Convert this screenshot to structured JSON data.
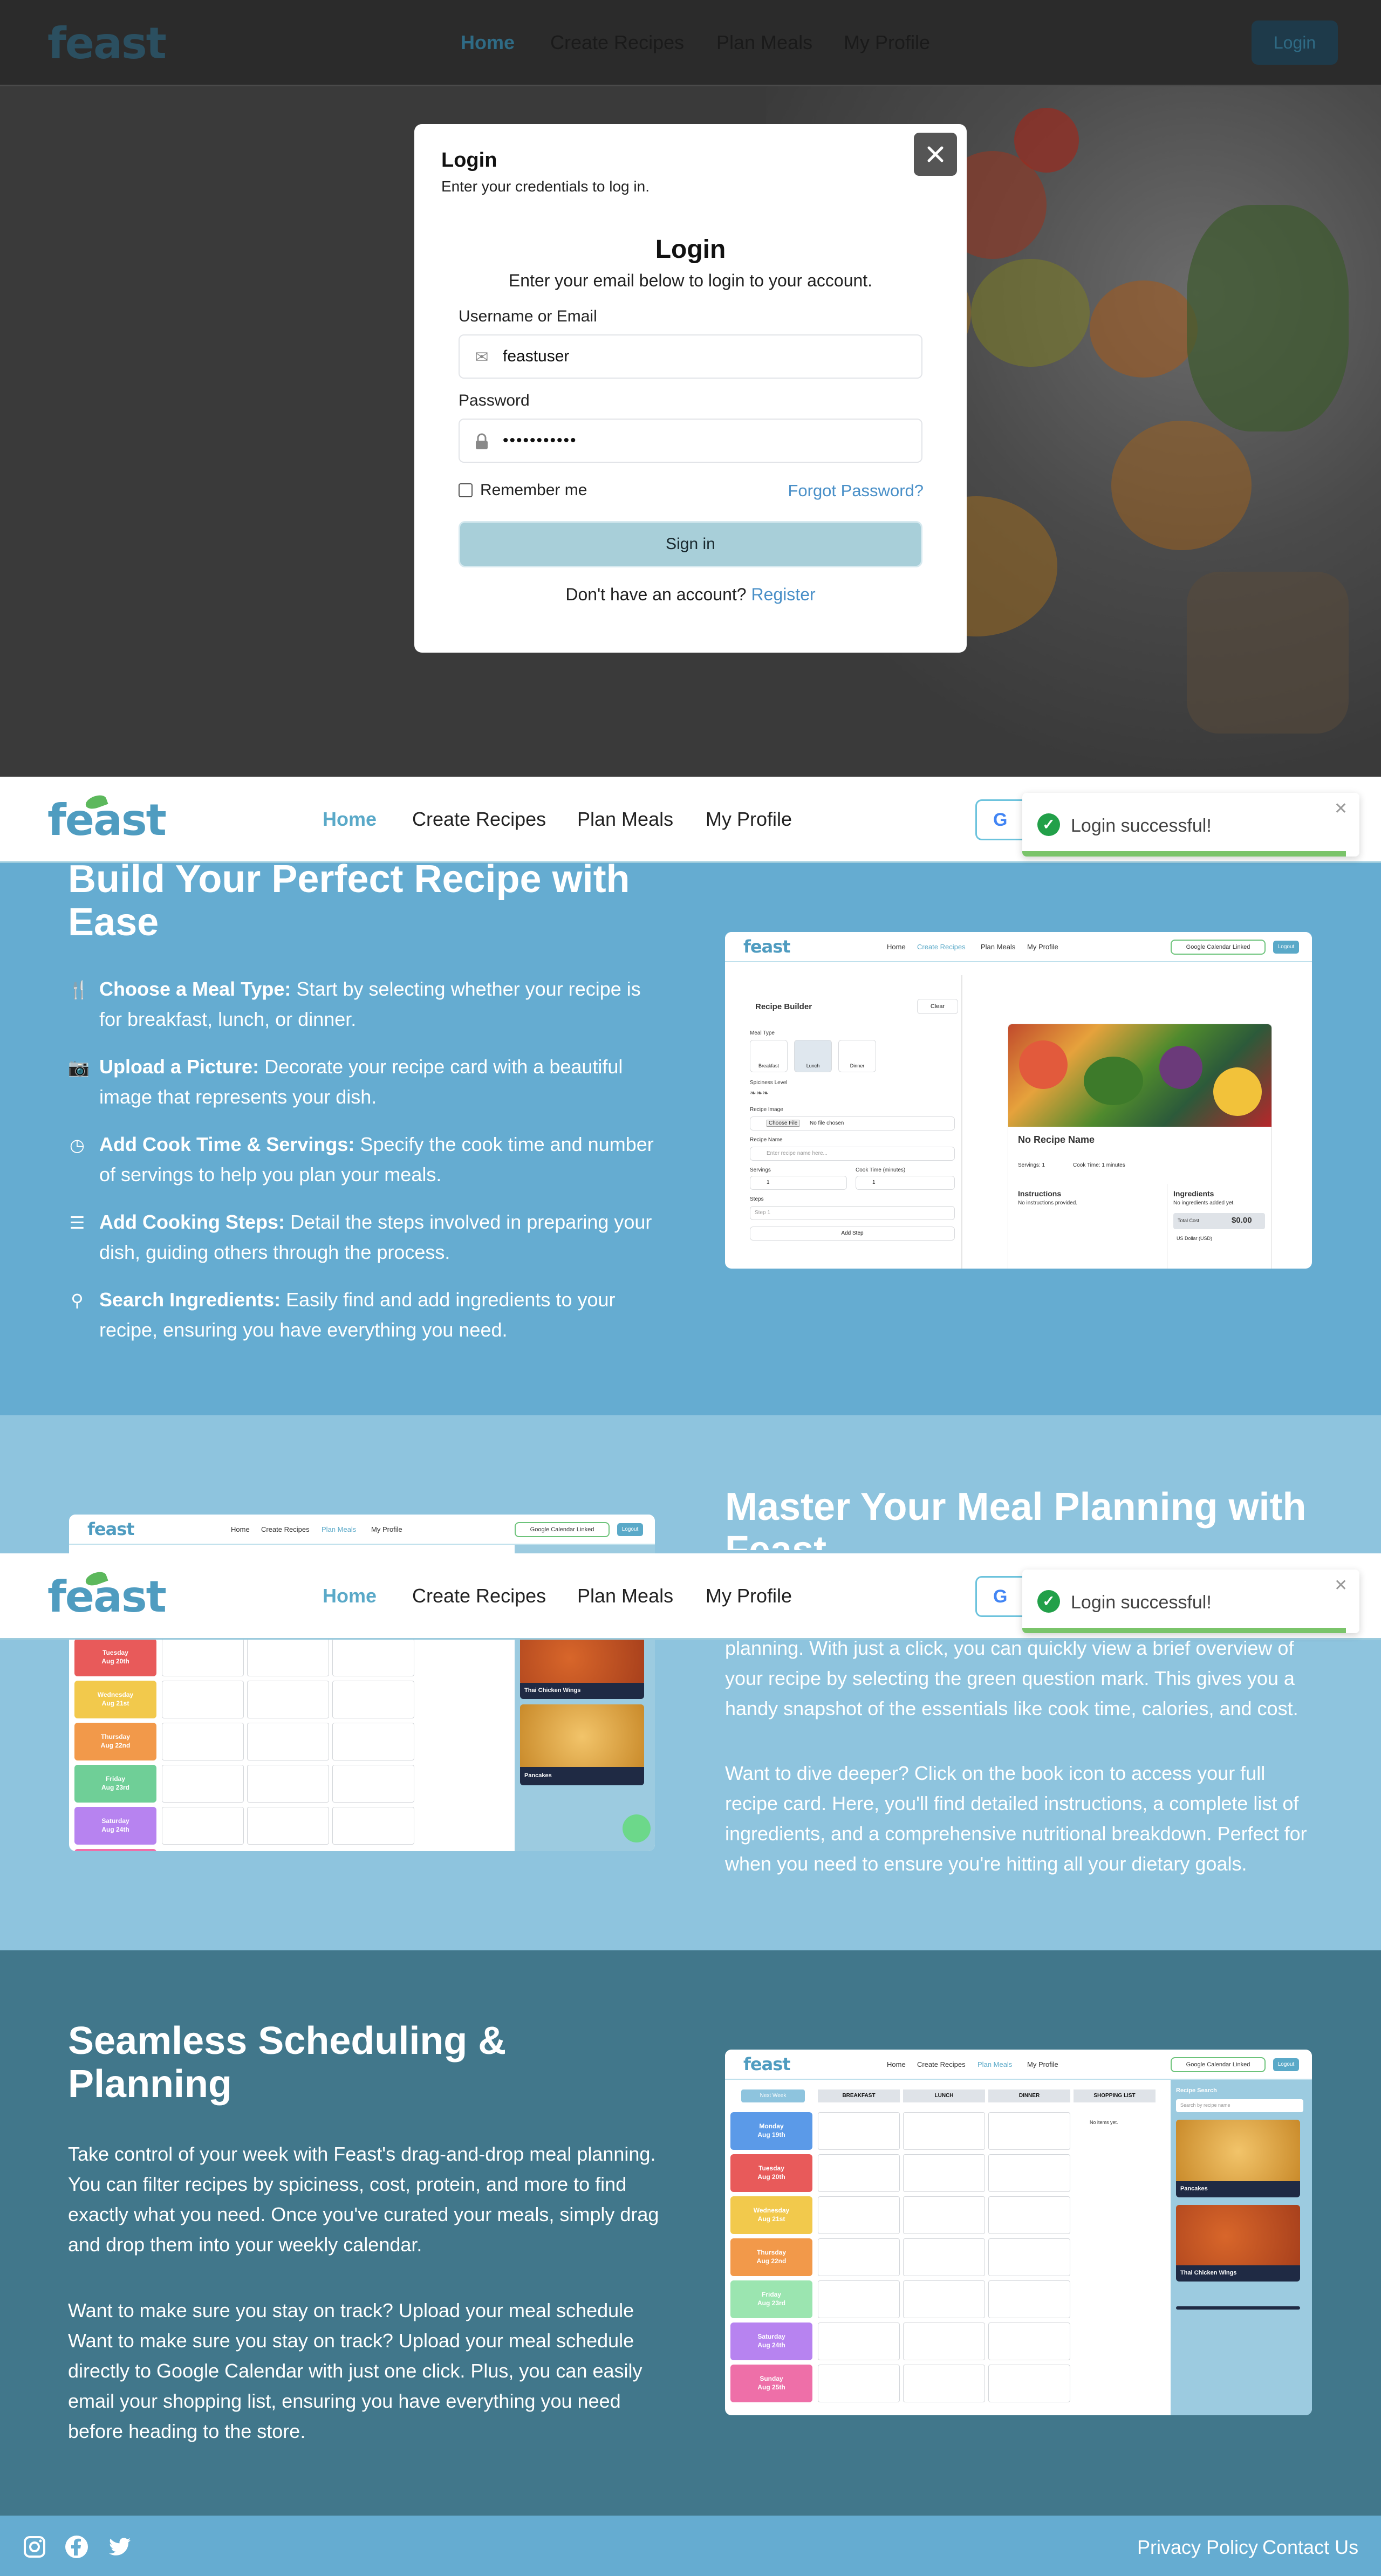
{
  "brand": {
    "logo": "feast",
    "accent": "#5aa9c8",
    "logo_color": "#4f9cc0",
    "leaf_color": "#5cb85c"
  },
  "nav": {
    "links": [
      "Home",
      "Create Recipes",
      "Plan Meals",
      "My Profile"
    ],
    "login_button": "Login"
  },
  "modal": {
    "header_title": "Login",
    "header_subtitle": "Enter your credentials to log in.",
    "title": "Login",
    "subtitle": "Enter your email below to login to your account.",
    "username_label": "Username or Email",
    "username_value": "feastuser",
    "password_label": "Password",
    "password_value": "•••••••••••",
    "remember_label": "Remember me",
    "forgot_link": "Forgot Password?",
    "submit": "Sign in",
    "no_account": "Don't have an account?",
    "register_link": "Register"
  },
  "toast": {
    "message": "Login successful!"
  },
  "feature1": {
    "title": "Build Your Perfect Recipe with Ease",
    "items": [
      {
        "icon": "utensils-icon",
        "bold": "Choose a Meal Type:",
        "text": "Start by selecting whether your recipe is for breakfast, lunch, or dinner."
      },
      {
        "icon": "camera-icon",
        "bold": "Upload a Picture:",
        "text": "Decorate your recipe card with a beautiful image that represents your dish."
      },
      {
        "icon": "clock-icon",
        "bold": "Add Cook Time & Servings:",
        "text": "Specify the cook time and number of servings to help you plan your meals."
      },
      {
        "icon": "list-icon",
        "bold": "Add Cooking Steps:",
        "text": "Detail the steps involved in preparing your dish, guiding others through the process."
      },
      {
        "icon": "search-icon",
        "bold": "Search Ingredients:",
        "text": "Easily find and add ingredients to your recipe, ensuring you have everything you need."
      }
    ],
    "shot": {
      "nav": [
        "Home",
        "Create Recipes",
        "Plan Meals",
        "My Profile"
      ],
      "calendar_btn": "Google Calendar Linked",
      "logout": "Logout",
      "builder_title": "Recipe Builder",
      "clear": "Clear",
      "meal_type": "Meal Type",
      "meals": [
        "Breakfast",
        "Lunch",
        "Dinner"
      ],
      "spiciness": "Spiciness Level",
      "recipe_image": "Recipe Image",
      "choose_file": "Choose File",
      "no_file": "No file chosen",
      "recipe_name_label": "Recipe Name",
      "recipe_name_placeholder": "Enter recipe name here...",
      "servings": "Servings",
      "cook_time": "Cook Time (minutes)",
      "steps": "Steps",
      "step_placeholder": "Step 1",
      "add_step": "Add Step",
      "card_title": "No Recipe Name",
      "card_servings": "Servings: 1",
      "card_cook": "Cook Time: 1 minutes",
      "instructions": "Instructions",
      "no_instructions": "No instructions provided.",
      "ingredients": "Ingredients",
      "no_ingredients": "No ingredients added yet.",
      "total_cost": "Total Cost",
      "total_value": "$0.00",
      "currency": "US Dollar (USD)"
    }
  },
  "feature2": {
    "title": "Master Your Meal Planning with Feast",
    "para1": "planning. With just a click, you can quickly view a brief overview of your recipe by selecting the green question mark. This gives you a handy snapshot of the essentials like cook time, calories, and cost.",
    "para2": "Want to dive deeper? Click on the book icon to access your full recipe card. Here, you'll find detailed instructions, a complete list of ingredients, and a comprehensive nutritional breakdown. Perfect for when you need to ensure you're hitting all your dietary goals.",
    "shot": {
      "days": [
        "Tuesday",
        "Wednesday",
        "Thursday",
        "Friday",
        "Saturday"
      ],
      "dates": [
        "Aug 20th",
        "Aug 21st",
        "Aug 22nd",
        "Aug 23rd",
        "Aug 24th"
      ],
      "recipes": [
        "Thai Chicken Wings",
        "Pancakes"
      ]
    }
  },
  "feature3": {
    "title": "Seamless Scheduling & Planning",
    "para1": "Take control of your week with Feast's drag-and-drop meal planning. You can filter recipes by spiciness, cost, protein, and more to find exactly what you need. Once you've curated your meals, simply drag and drop them into your weekly calendar.",
    "para2": "Want to make sure you stay on track? Upload your meal schedule Want to make sure you stay on track? Upload your meal schedule directly to Google Calendar with just one click. Plus, you can easily email your shopping list, ensuring you have everything you need before heading to the store.",
    "shot": {
      "next_week": "Next Week",
      "columns": [
        "BREAKFAST",
        "LUNCH",
        "DINNER",
        "SHOPPING LIST"
      ],
      "no_items": "No items yet.",
      "days": [
        "Monday",
        "Tuesday",
        "Wednesday",
        "Thursday",
        "Friday",
        "Saturday",
        "Sunday"
      ],
      "dates": [
        "Aug 19th",
        "Aug 20th",
        "Aug 21st",
        "Aug 22nd",
        "Aug 23rd",
        "Aug 24th",
        "Aug 25th"
      ],
      "search_title": "Recipe Search",
      "search_placeholder": "Search by recipe name",
      "recipes": [
        "Pancakes",
        "Thai Chicken Wings"
      ]
    }
  },
  "footer": {
    "icons": [
      "instagram-icon",
      "facebook-icon",
      "twitter-icon"
    ],
    "links": [
      "Privacy Policy",
      "Contact Us"
    ]
  }
}
